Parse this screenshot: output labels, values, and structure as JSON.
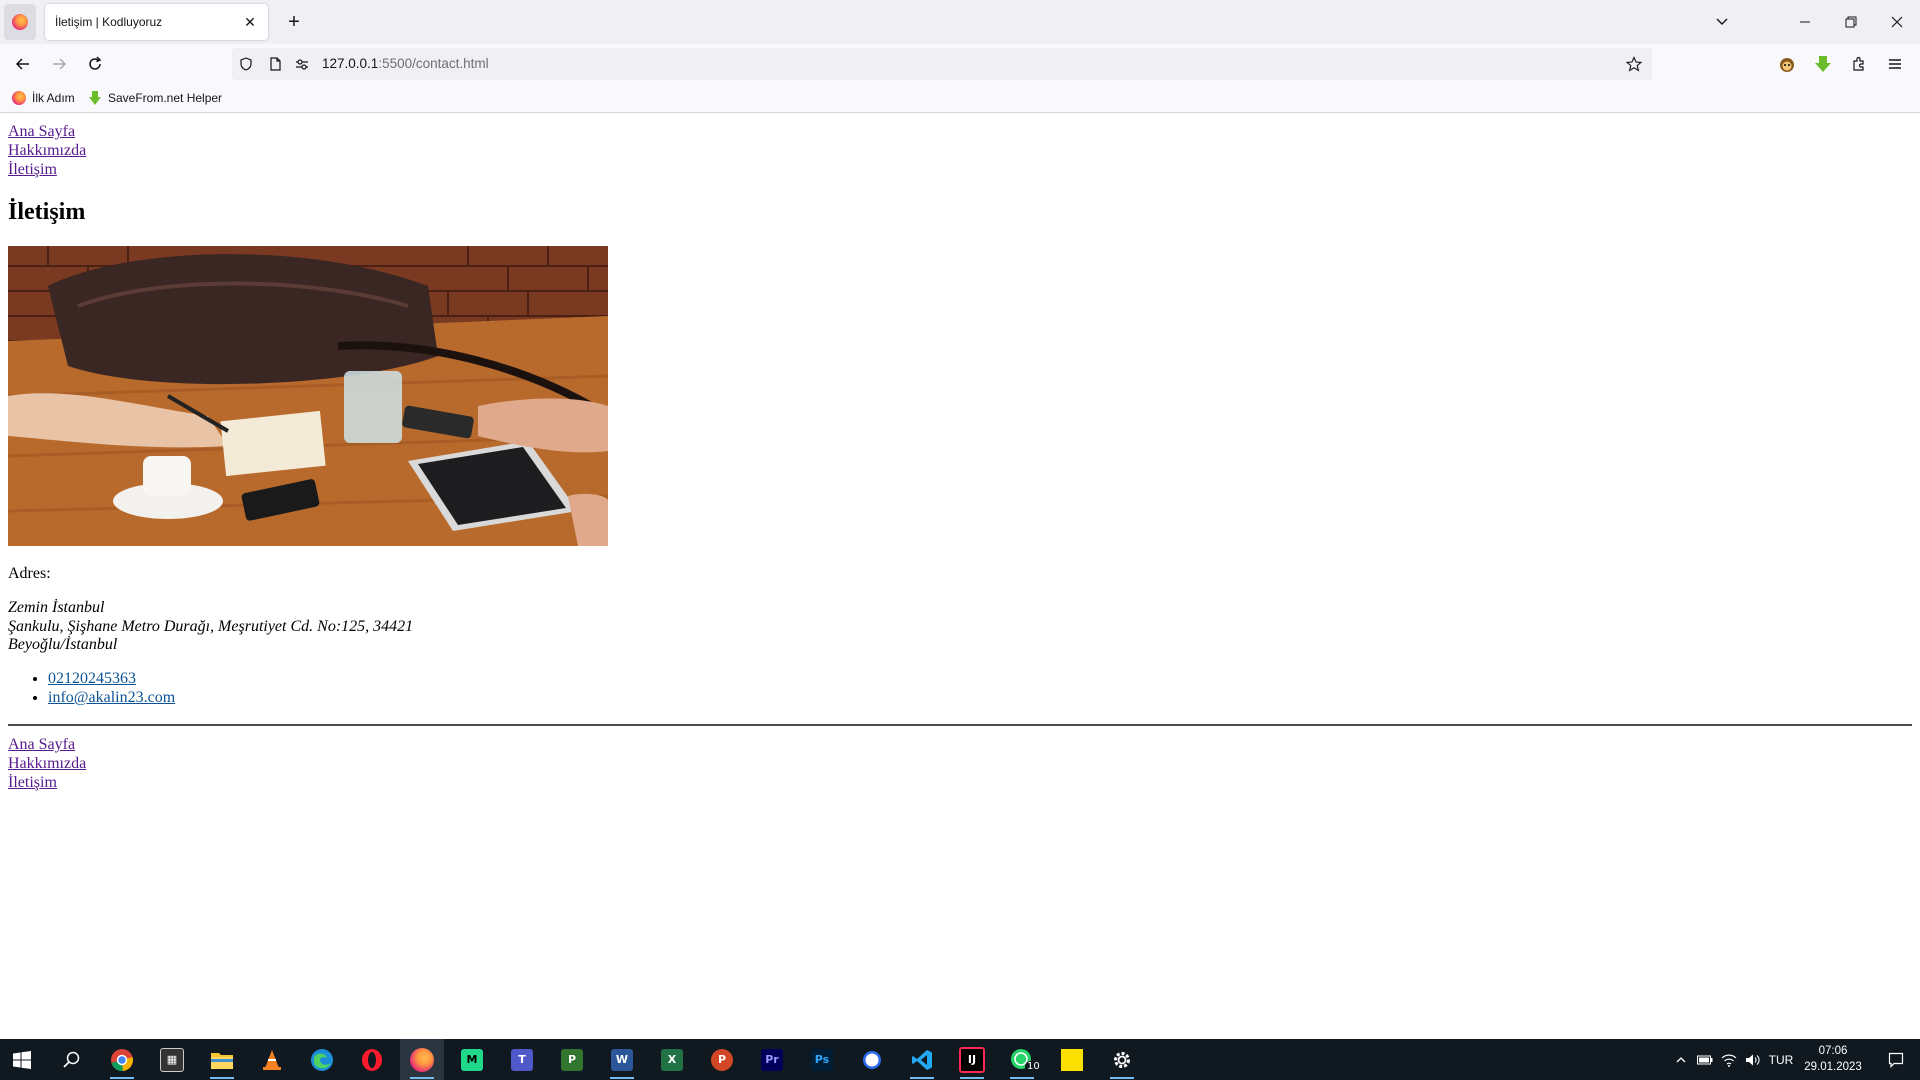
{
  "browser": {
    "tab": {
      "title": "İletişim | Kodluyoruz"
    },
    "url": {
      "host": "127.0.0.1",
      "rest": ":5500/contact.html"
    },
    "bookmarks": [
      {
        "label": "İlk Adım"
      },
      {
        "label": "SaveFrom.net Helper"
      }
    ]
  },
  "page": {
    "nav": [
      "Ana Sayfa",
      "Hakkımızda",
      "İletişim"
    ],
    "title": "İletişim",
    "address_label": "Adres:",
    "address_lines": [
      "Zemin İstanbul",
      "Şankulu, Şişhane Metro Durağı, Meşrutiyet Cd. No:125, 34421",
      "Beyoğlu/İstanbul"
    ],
    "contacts": [
      "02120245363",
      "info@akalin23.com"
    ],
    "footer_nav": [
      "Ana Sayfa",
      "Hakkımızda",
      "İletişim"
    ]
  },
  "taskbar": {
    "language": "TUR",
    "time": "07:06",
    "date": "29.01.2023",
    "whatsapp_badge": "10"
  }
}
